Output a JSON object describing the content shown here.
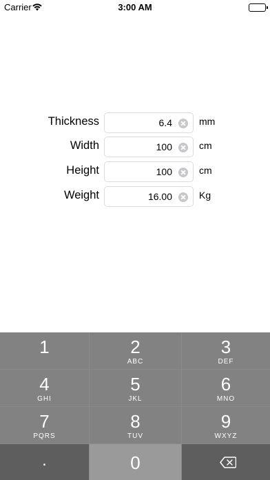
{
  "status_bar": {
    "carrier": "Carrier",
    "time": "3:00 AM"
  },
  "form": {
    "rows": [
      {
        "label": "Thickness",
        "value": "6.4",
        "unit": "mm"
      },
      {
        "label": "Width",
        "value": "100",
        "unit": "cm"
      },
      {
        "label": "Height",
        "value": "100",
        "unit": "cm"
      },
      {
        "label": "Weight",
        "value": "16.00",
        "unit": "Kg"
      }
    ]
  },
  "keypad": {
    "keys": [
      {
        "num": "1",
        "letters": ""
      },
      {
        "num": "2",
        "letters": "ABC"
      },
      {
        "num": "3",
        "letters": "DEF"
      },
      {
        "num": "4",
        "letters": "GHI"
      },
      {
        "num": "5",
        "letters": "JKL"
      },
      {
        "num": "6",
        "letters": "MNO"
      },
      {
        "num": "7",
        "letters": "PQRS"
      },
      {
        "num": "8",
        "letters": "TUV"
      },
      {
        "num": "9",
        "letters": "WXYZ"
      }
    ],
    "decimal": ".",
    "zero": "0",
    "backspace_icon": "backspace-icon"
  }
}
